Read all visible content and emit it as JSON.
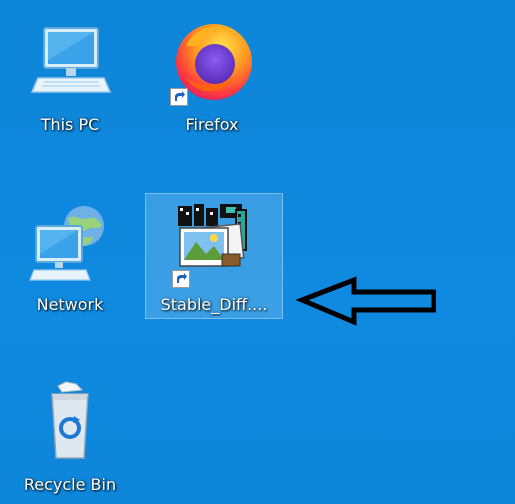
{
  "desktop": {
    "background_color": "#0f86d6",
    "icons": [
      {
        "label": "This PC",
        "icon": "computer-icon"
      },
      {
        "label": "Firefox",
        "icon": "firefox-icon",
        "shortcut": true
      },
      {
        "label": "Network",
        "icon": "network-icon"
      },
      {
        "label": "Stable_Diff....",
        "icon": "stable-diffusion-icon",
        "shortcut": true,
        "selected": true
      },
      {
        "label": "Recycle Bin",
        "icon": "recycle-bin-icon"
      }
    ]
  },
  "annotation": {
    "icon": "left-arrow-icon",
    "color": "#000000"
  }
}
